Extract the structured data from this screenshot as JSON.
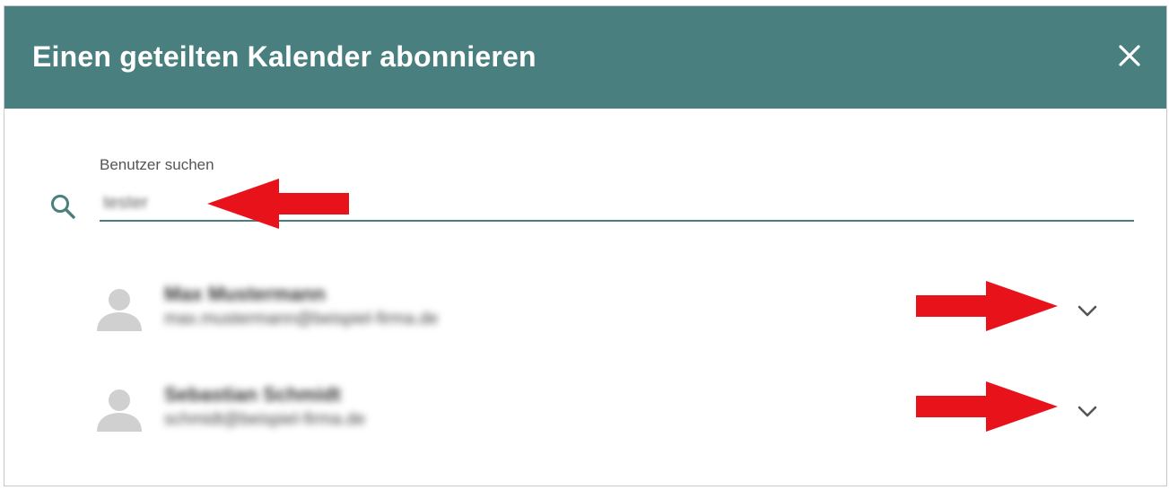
{
  "dialog": {
    "title": "Einen geteilten Kalender abonnieren",
    "close_icon": "close-icon"
  },
  "search": {
    "label": "Benutzer suchen",
    "value": "tester",
    "icon": "search-icon"
  },
  "users": [
    {
      "name": "Max Mustermann",
      "email": "max.mustermann@beispiel-firma.de",
      "avatar_icon": "person-icon",
      "expand_icon": "chevron-down-icon"
    },
    {
      "name": "Sebastian Schmidt",
      "email": "schmidt@beispiel-firma.de",
      "avatar_icon": "person-icon",
      "expand_icon": "chevron-down-icon"
    }
  ],
  "colors": {
    "header": "#4a7f7f",
    "annotation_arrow": "#e8121a",
    "avatar": "#d0d0d0"
  }
}
